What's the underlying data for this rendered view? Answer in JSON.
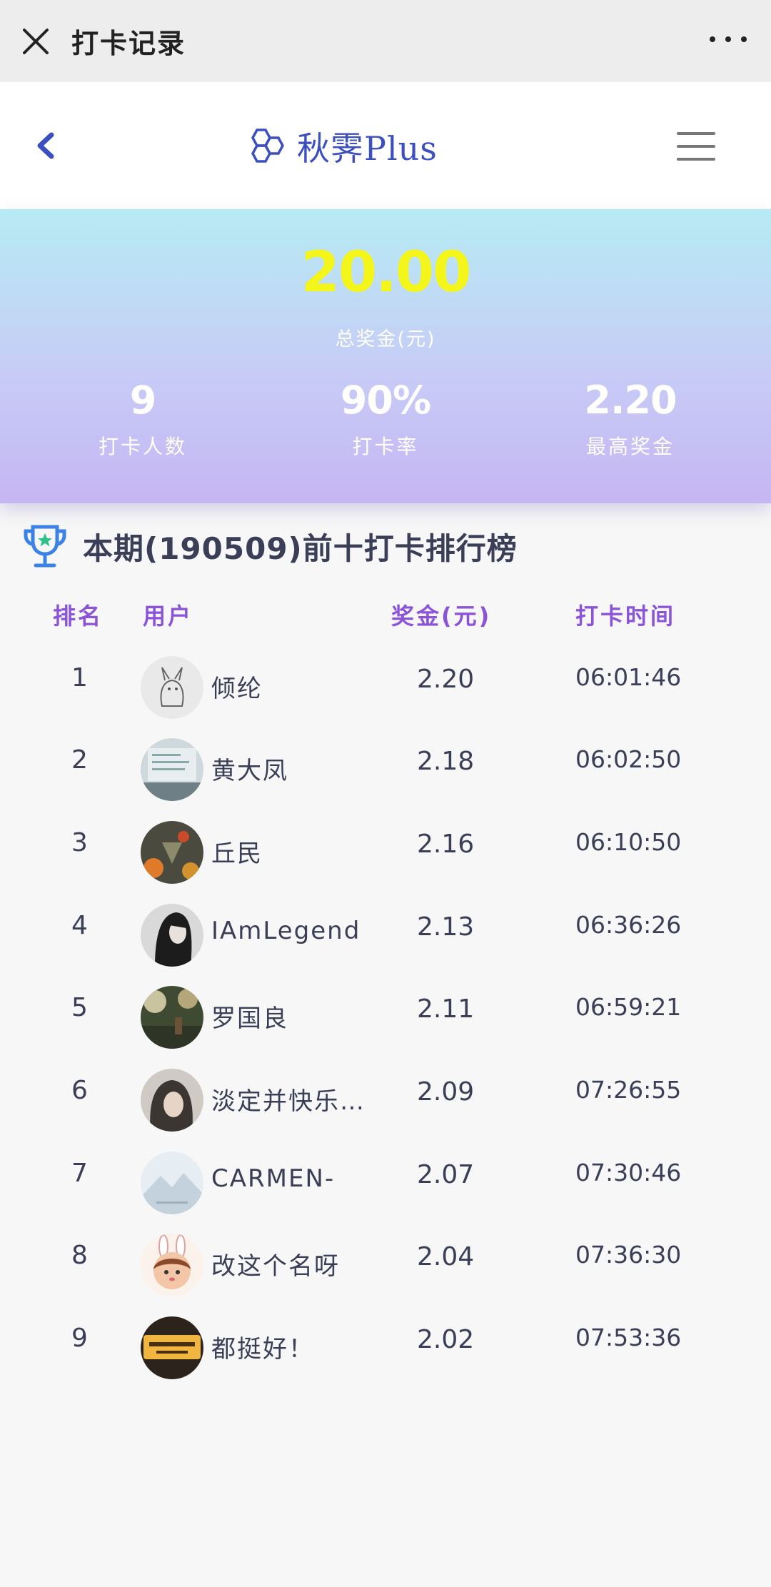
{
  "topbar": {
    "title": "打卡记录"
  },
  "header": {
    "brand": "秋霁Plus"
  },
  "banner": {
    "total": "20.00",
    "total_label": "总奖金(元)",
    "stats": [
      {
        "value": "9",
        "label": "打卡人数"
      },
      {
        "value": "90%",
        "label": "打卡率"
      },
      {
        "value": "2.20",
        "label": "最高奖金"
      }
    ]
  },
  "ranking": {
    "title": "本期(190509)前十打卡排行榜",
    "columns": {
      "rank": "排名",
      "user": "用户",
      "prize": "奖金(元)",
      "time": "打卡时间"
    },
    "rows": [
      {
        "rank": "1",
        "user": "倾纶",
        "prize": "2.20",
        "time": "06:01:46"
      },
      {
        "rank": "2",
        "user": "黄大凤",
        "prize": "2.18",
        "time": "06:02:50"
      },
      {
        "rank": "3",
        "user": "丘民",
        "prize": "2.16",
        "time": "06:10:50"
      },
      {
        "rank": "4",
        "user": "IAmLegend",
        "prize": "2.13",
        "time": "06:36:26"
      },
      {
        "rank": "5",
        "user": "罗国良",
        "prize": "2.11",
        "time": "06:59:21"
      },
      {
        "rank": "6",
        "user": "淡定并快乐…",
        "prize": "2.09",
        "time": "07:26:55"
      },
      {
        "rank": "7",
        "user": "CARMEN-",
        "prize": "2.07",
        "time": "07:30:46"
      },
      {
        "rank": "8",
        "user": "改这个名呀",
        "prize": "2.04",
        "time": "07:36:30"
      },
      {
        "rank": "9",
        "user": "都挺好！",
        "prize": "2.02",
        "time": "07:53:36"
      }
    ]
  },
  "colors": {
    "accent": "#3b4fbf",
    "header_label": "#8a53d8",
    "total": "#f4f51b"
  }
}
